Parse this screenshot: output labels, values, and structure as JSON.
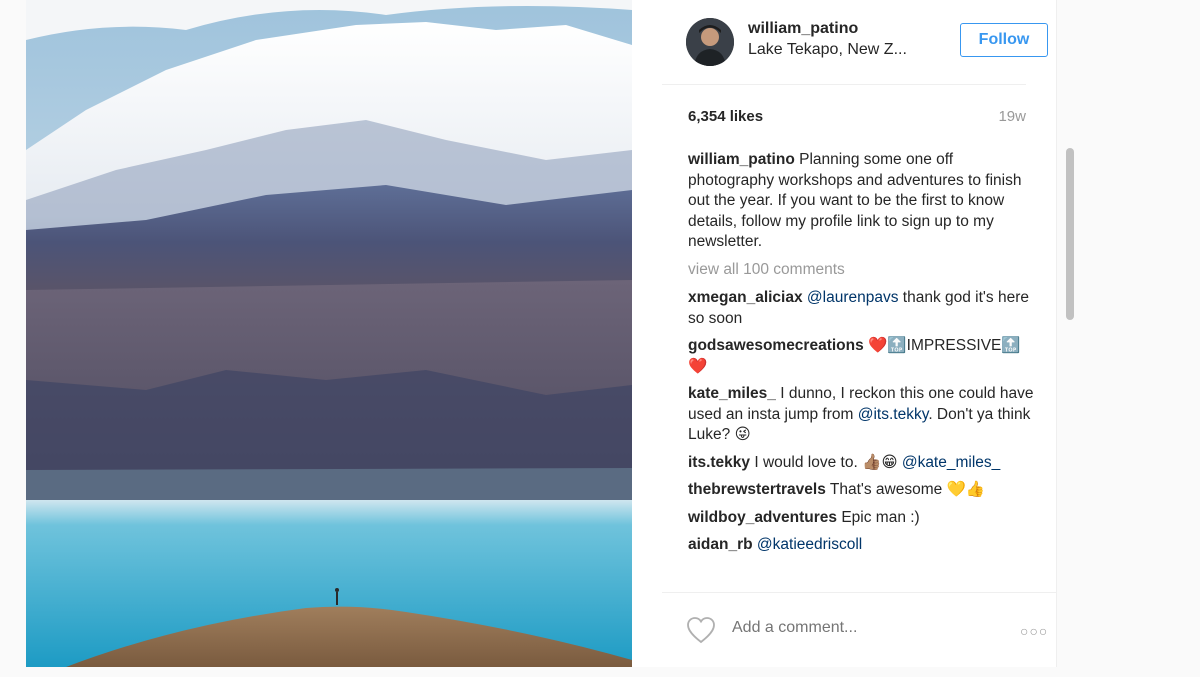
{
  "post": {
    "username": "william_patino",
    "location": "Lake Tekapo, New Z...",
    "follow_label": "Follow",
    "likes": "6,354 likes",
    "age": "19w"
  },
  "caption": {
    "user": "william_patino",
    "text": "Planning some one off photography workshops and adventures to finish out the year. If you want to be the first to know details, follow my profile link to sign up to my newsletter."
  },
  "view_all": "view all 100 comments",
  "comments": [
    {
      "user": "xmegan_aliciax",
      "mention": "@laurenpavs",
      "text": " thank god it's here so soon",
      "emoji": ""
    },
    {
      "user": "godsawesomecreations",
      "mention": "",
      "text": " ❤️🔝IMPRESSIVE🔝❤️",
      "emoji": ""
    },
    {
      "user": "kate_miles_",
      "mention": "",
      "text": " I dunno, I reckon this one could have used an insta jump from ",
      "mention2": "@its.tekky",
      "text2": ". Don't ya think Luke? 😜"
    },
    {
      "user": "its.tekky",
      "mention": "",
      "text": " I would love to. 👍🏽😁 ",
      "mention2": "@kate_miles_",
      "text2": ""
    },
    {
      "user": "thebrewstertravels",
      "mention": "",
      "text": " That's awesome 💛👍",
      "emoji": ""
    },
    {
      "user": "wildboy_adventures",
      "mention": "",
      "text": " Epic man :)",
      "emoji": ""
    },
    {
      "user": "aidan_rb",
      "mention": "@katieedriscoll",
      "text": "",
      "emoji": ""
    }
  ],
  "footer": {
    "add_comment_placeholder": "Add a comment...",
    "more": "○○○"
  },
  "icons": [
    "heart-icon",
    "more-options-icon",
    "avatar"
  ]
}
